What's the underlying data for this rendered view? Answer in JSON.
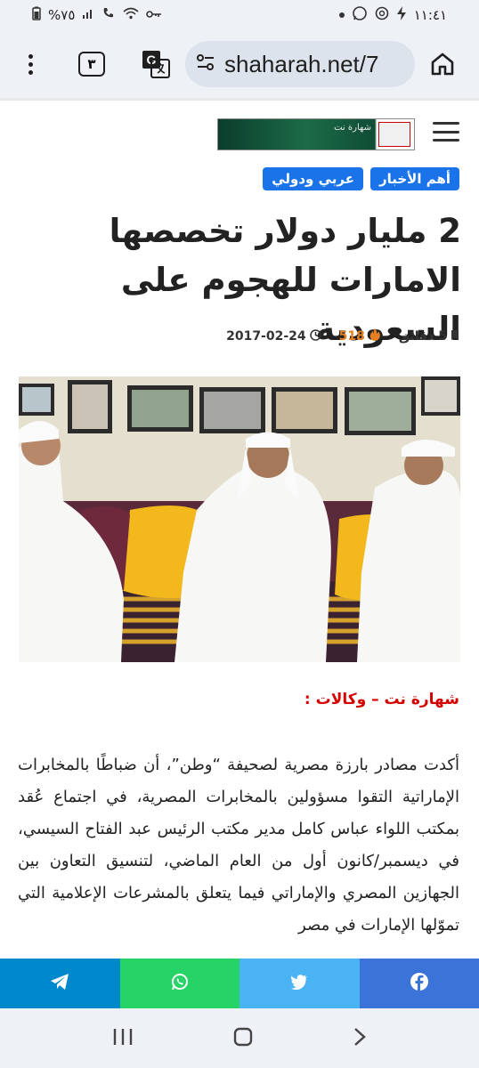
{
  "status_bar": {
    "time": "١١:٤١",
    "battery": "%٧٥"
  },
  "browser": {
    "tab_count": "٣",
    "url": "shaharah.net/7"
  },
  "site": {
    "logo_text": "شهارة نت"
  },
  "article": {
    "tags": [
      "أهم الأخبار",
      "عربي ودولي"
    ],
    "title": "2 مليار دولار تخصصها الامارات للهجوم على السعودية",
    "date": "2017-02-24",
    "views": "518",
    "read_time": "5 دقائق",
    "source": "شهارة نت – وكالات :",
    "body": "أكدت مصادر بارزة مصرية لصحيفة “وطن”، أن ضباطًا بالمخابرات الإماراتية التقوا مسؤولين بالمخابرات المصرية، في اجتماع عُقد بمكتب اللواء عباس كامل مدير مكتب الرئيس عبد الفتاح السيسي، في ديسمبر/كانون أول من العام الماضي، لتنسيق التعاون بين الجهازين المصري والإماراتي فيما يتعلق بالمشرعات الإعلامية التي تموّلها الإمارات في مصر"
  },
  "share": {
    "buttons": [
      "telegram",
      "whatsapp",
      "twitter",
      "facebook"
    ],
    "colors": {
      "telegram": "#0088cc",
      "whatsapp": "#25d366",
      "twitter": "#4ab3f4",
      "facebook": "#3b73d8"
    }
  },
  "colors": {
    "accent": "#1a73e8",
    "source_red": "#d40000",
    "views_orange": "#e67e22"
  }
}
